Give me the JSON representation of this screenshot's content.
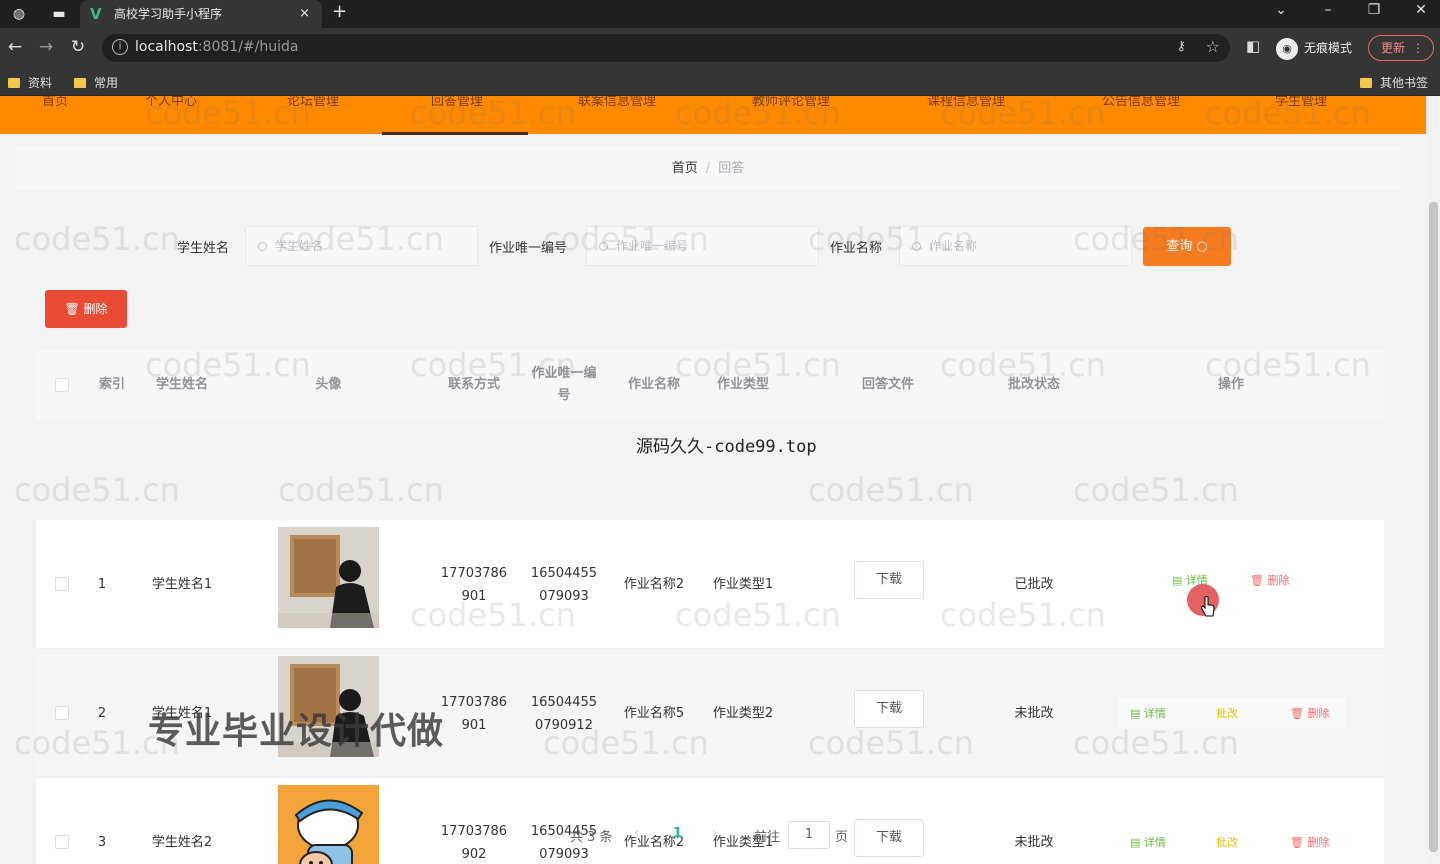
{
  "browser": {
    "tab_title": "高校学习助手小程序",
    "tab_close": "×",
    "new_tab": "+",
    "url_host": "localhost",
    "url_rest": ":8081/#/huida",
    "incognito_label": "无痕模式",
    "update_label": "更新",
    "bookmarks": [
      "资料",
      "常用"
    ],
    "other_bookmarks": "其他书签"
  },
  "nav": {
    "items": [
      "首页",
      "个人中心",
      "论坛管理",
      "回答管理",
      "联案信息管理",
      "教师评论管理",
      "课程信息管理",
      "公告信息管理",
      "学生管理"
    ]
  },
  "breadcrumb": {
    "home": "首页",
    "separator": "/",
    "current": "回答"
  },
  "filters": {
    "student_name_label": "学生姓名",
    "student_name_placeholder": "学生姓名",
    "homework_id_label": "作业唯一编号",
    "homework_id_placeholder": "作业唯一编号",
    "homework_name_label": "作业名称",
    "homework_name_placeholder": "作业名称",
    "query_label": "查询"
  },
  "actions": {
    "batch_delete_label": "删除"
  },
  "table": {
    "headers": [
      "索引",
      "学生姓名",
      "头像",
      "联系方式",
      "作业唯一编号",
      "作业名称",
      "作业类型",
      "回答文件",
      "批改状态",
      "操作"
    ],
    "rows": [
      {
        "index": "1",
        "student": "学生姓名1",
        "phone_a": "17703786",
        "phone_b": "901",
        "hwid_a": "16504455",
        "hwid_b": "079093",
        "hw_name": "作业名称2",
        "hw_type": "作业类型1",
        "file": "下载",
        "status": "已批改",
        "detail": "详情",
        "edit": "",
        "del": "删除"
      },
      {
        "index": "2",
        "student": "学生姓名1",
        "phone_a": "17703786",
        "phone_b": "901",
        "hwid_a": "16504455",
        "hwid_b": "0790912",
        "hw_name": "作业名称5",
        "hw_type": "作业类型2",
        "file": "下载",
        "status": "未批改",
        "detail": "详情",
        "edit": "批改",
        "del": "删除"
      },
      {
        "index": "3",
        "student": "学生姓名2",
        "phone_a": "17703786",
        "phone_b": "902",
        "hwid_a": "16504455",
        "hwid_b": "079093",
        "hw_name": "作业名称2",
        "hw_type": "作业类型1",
        "file": "下载",
        "status": "未批改",
        "detail": "详情",
        "edit": "批改",
        "del": "删除"
      }
    ]
  },
  "pagination": {
    "total": "共 3 条",
    "current": "1",
    "goto": "前往",
    "page_value": "1",
    "page_unit": "页"
  },
  "overlays": {
    "site_watermark": "源码久久-code99.top",
    "promo": "专业毕业设计代做",
    "tile": "code51.cn"
  },
  "colors": {
    "nav": "#ff8a00",
    "query": "#f77b1f",
    "delete": "#ea4b35",
    "detail": "#67c23a",
    "danger": "#f56c6c",
    "pager_active": "#1abc9c"
  }
}
